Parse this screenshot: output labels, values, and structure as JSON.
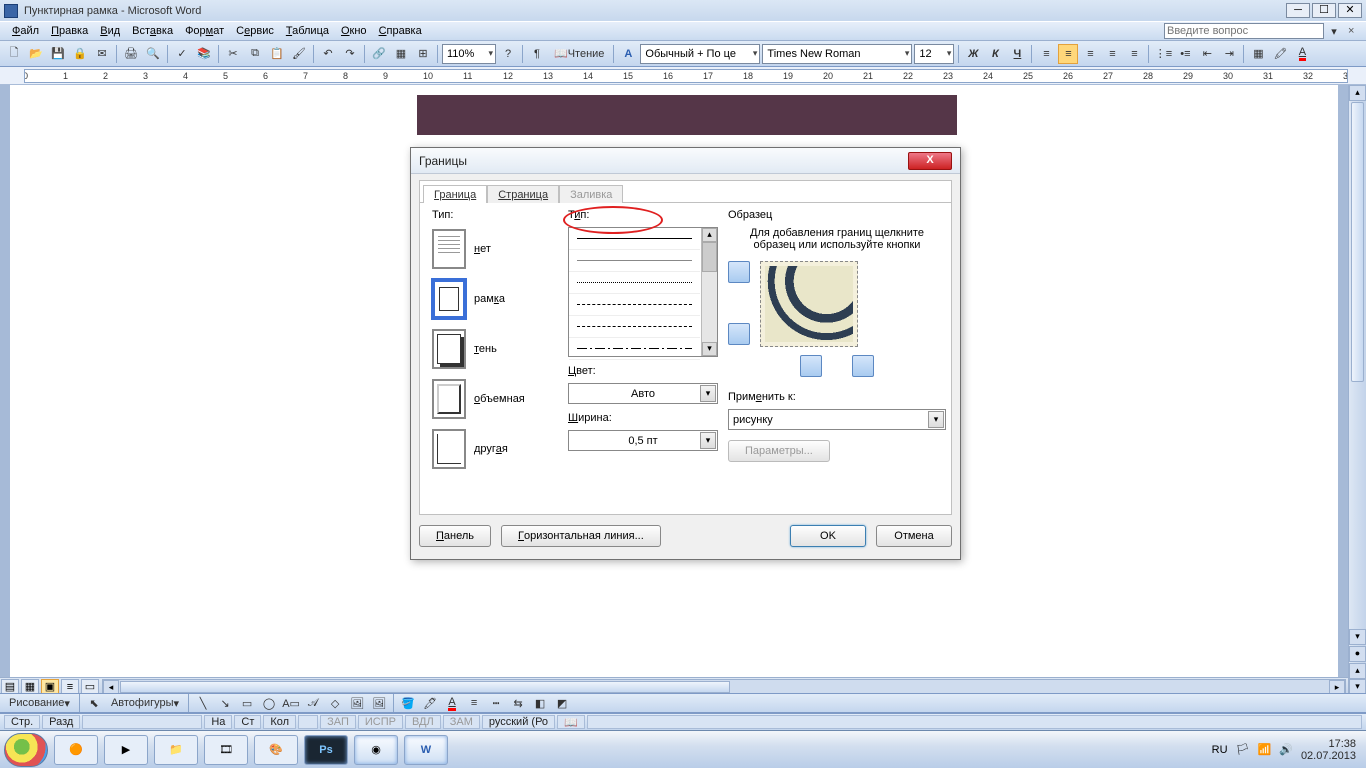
{
  "app": {
    "title": "Пунктирная рамка - Microsoft Word"
  },
  "menu": {
    "items": [
      "Файл",
      "Правка",
      "Вид",
      "Вставка",
      "Формат",
      "Сервис",
      "Таблица",
      "Окно",
      "Справка"
    ],
    "ask_placeholder": "Введите вопрос"
  },
  "toolbar1": {
    "zoom": "110%",
    "read": "Чтение"
  },
  "toolbar2": {
    "style": "Обычный + По це",
    "font": "Times New Roman",
    "size": "12"
  },
  "dialog": {
    "title": "Границы",
    "tabs": {
      "border": "Граница",
      "page": "Страница",
      "fill": "Заливка"
    },
    "labels": {
      "type": "Тип:",
      "style": "Тип:",
      "color": "Цвет:",
      "width": "Ширина:",
      "preview": "Образец",
      "preview_hint": "Для добавления границ щелкните образец или используйте кнопки",
      "apply_to": "Применить к:"
    },
    "settings": {
      "none": "нет",
      "box": "рамка",
      "shadow": "тень",
      "threeD": "объемная",
      "custom": "другая"
    },
    "color_value": "Авто",
    "width_value": "0,5 пт",
    "apply_value": "рисунку",
    "buttons": {
      "panel": "Панель",
      "hline": "Горизонтальная линия...",
      "ok": "OK",
      "cancel": "Отмена",
      "options": "Параметры..."
    }
  },
  "drawbar": {
    "label": "Рисование",
    "autoshapes": "Автофигуры"
  },
  "status": {
    "page": "Стр.",
    "sect": "Разд",
    "at": "На",
    "line": "Ст",
    "col": "Кол",
    "rec": "ЗАП",
    "trk": "ИСПР",
    "ext": "ВДЛ",
    "ovr": "ЗАМ",
    "lang": "русский (Ро"
  },
  "taskbar": {
    "lang": "RU",
    "time": "17:38",
    "date": "02.07.2013"
  }
}
